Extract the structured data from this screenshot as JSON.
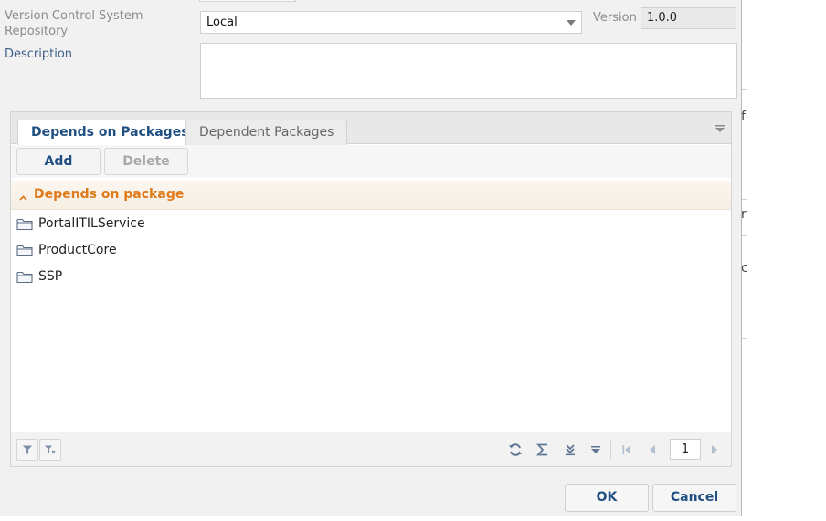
{
  "form": {
    "vcs_label": "Version Control System Repository",
    "vcs_value": "Local",
    "version_label": "Version",
    "version_value": "1.0.0",
    "description_label": "Description",
    "description_value": ""
  },
  "tabs": [
    {
      "label": "Depends on Packages",
      "active": true
    },
    {
      "label": "Dependent Packages",
      "active": false
    }
  ],
  "toolbar": {
    "add_label": "Add",
    "delete_label": "Delete"
  },
  "group": {
    "label": "Depends on package"
  },
  "rows": [
    {
      "name": "PortalITILService",
      "icon": "folder-icon"
    },
    {
      "name": "ProductCore",
      "icon": "folder-icon"
    },
    {
      "name": "SSP",
      "icon": "folder-icon"
    }
  ],
  "pager": {
    "page": "1"
  },
  "footer": {
    "ok_label": "OK",
    "cancel_label": "Cancel"
  },
  "backdrop": {
    "chars": [
      "f",
      "r",
      "c"
    ]
  },
  "colors": {
    "accent": "#1f4f80",
    "group_text": "#e07b1a",
    "label_gray": "#8b8b8b"
  }
}
